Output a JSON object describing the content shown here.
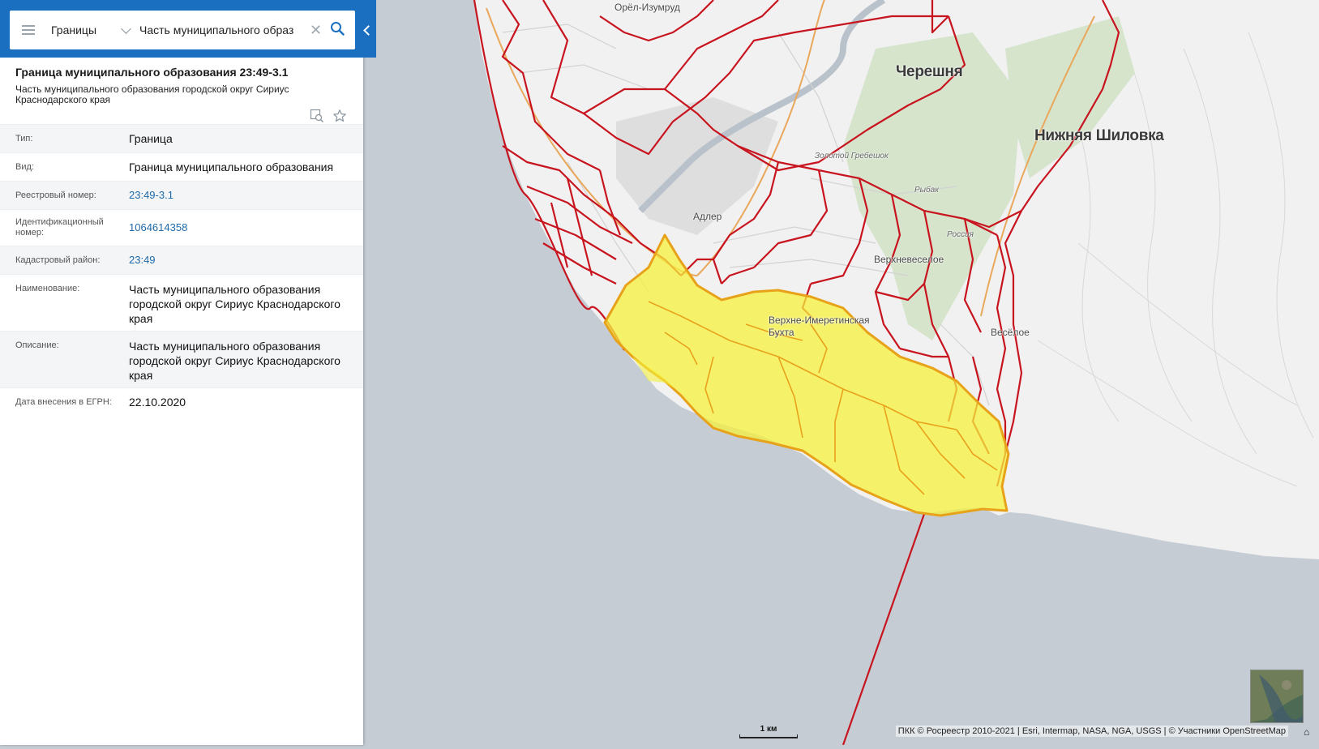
{
  "search": {
    "layer": "Границы",
    "value": "Часть муниципального образ",
    "clear_glyph": "✕"
  },
  "info": {
    "title": "Граница муниципального образования 23:49-3.1",
    "subtitle": "Часть муниципального образования городской округ Сириус Краснодарского края"
  },
  "attributes": [
    {
      "key": "Тип:",
      "value": "Граница"
    },
    {
      "key": "Вид:",
      "value": "Граница муниципального образования"
    },
    {
      "key": "Реестровый номер:",
      "value": "23:49-3.1"
    },
    {
      "key": "Идентификационный номер:",
      "value": "1064614358"
    },
    {
      "key": "Кадастровый район:",
      "value": "23:49"
    },
    {
      "key": "Наименование:",
      "value": "Часть муниципального образования городской округ Сириус Краснодарского края"
    },
    {
      "key": "Описание:",
      "value": "Часть муниципального образования городской округ Сириус Краснодарского края"
    },
    {
      "key": "Дата внесения в ЕГРН:",
      "value": "22.10.2020"
    }
  ],
  "map": {
    "labels": {
      "orel_izumrud": "Орёл-Изумруд",
      "chereshnya": "Черешня",
      "nizhnyaya_shilovka": "Нижняя Шиловка",
      "zolotoy_grebeshok": "Золотой Гребешок",
      "rybak": "Рыбак",
      "adler": "Адлер",
      "rossiya": "Россия",
      "verkhnevesyoloe": "Верхневеселое",
      "imeretinskaya": "Верхне-Имеретинская",
      "bukhta": "Бухта",
      "vesyoloe": "Весёлое"
    },
    "colors": {
      "boundary": "#c8141e",
      "selection_fill": "#f5f23c",
      "selection_stroke": "#e8a21a",
      "sea": "#c5ccd3",
      "land": "#f1f1f1",
      "forest": "#cfe0c4",
      "panel_header": "#1a6fc0"
    }
  },
  "footer": {
    "scale": "1 км",
    "attribution": "ПКК © Росреестр 2010-2021 | Esri, Intermap, NASA, NGA, USGS | © Участники OpenStreetMap",
    "home_glyph": "⌂"
  }
}
